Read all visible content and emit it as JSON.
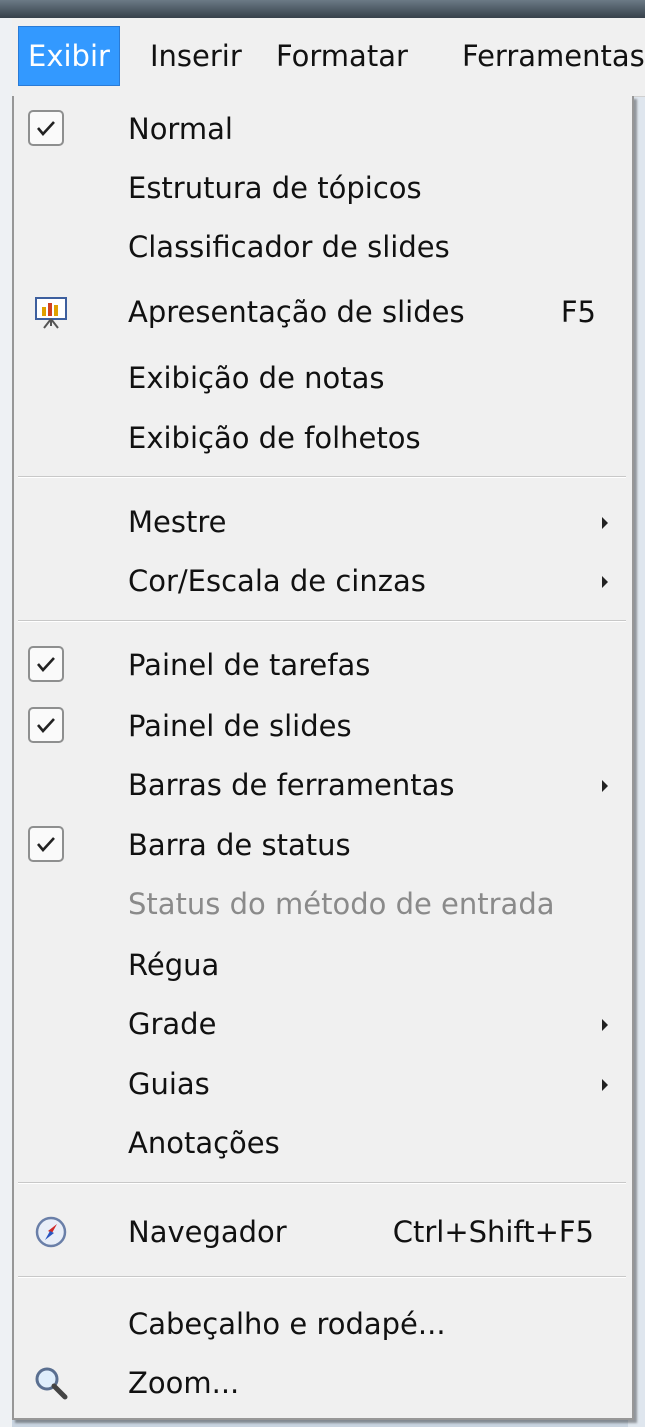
{
  "menubar": {
    "items": [
      "Exibir",
      "Inserir",
      "Formatar",
      "Ferramentas"
    ],
    "active": "Exibir"
  },
  "menu": {
    "items": [
      {
        "label": "Normal",
        "checked": true
      },
      {
        "label": "Estrutura de tópicos"
      },
      {
        "label": "Classificador de slides"
      },
      {
        "label": "Apresentação de slides",
        "shortcut": "F5",
        "icon": "slideshow-icon"
      },
      {
        "label": "Exibição de notas"
      },
      {
        "label": "Exibição de folhetos"
      },
      {
        "label": "Mestre",
        "submenu": true
      },
      {
        "label": "Cor/Escala de cinzas",
        "submenu": true
      },
      {
        "label": "Painel de tarefas",
        "checked": true
      },
      {
        "label": "Painel de slides",
        "checked": true
      },
      {
        "label": "Barras de ferramentas",
        "submenu": true
      },
      {
        "label": "Barra de status",
        "checked": true
      },
      {
        "label": "Status do método de entrada",
        "disabled": true
      },
      {
        "label": "Régua"
      },
      {
        "label": "Grade",
        "submenu": true
      },
      {
        "label": "Guias",
        "submenu": true
      },
      {
        "label": "Anotações"
      },
      {
        "label": "Navegador",
        "shortcut": "Ctrl+Shift+F5",
        "icon": "compass-icon"
      },
      {
        "label": "Cabeçalho e rodapé..."
      },
      {
        "label": "Zoom...",
        "icon": "magnifier-icon"
      }
    ]
  },
  "colors": {
    "highlight": "#3399ff",
    "menu_bg": "#f0f0f0",
    "disabled_text": "#8a8a8a"
  }
}
